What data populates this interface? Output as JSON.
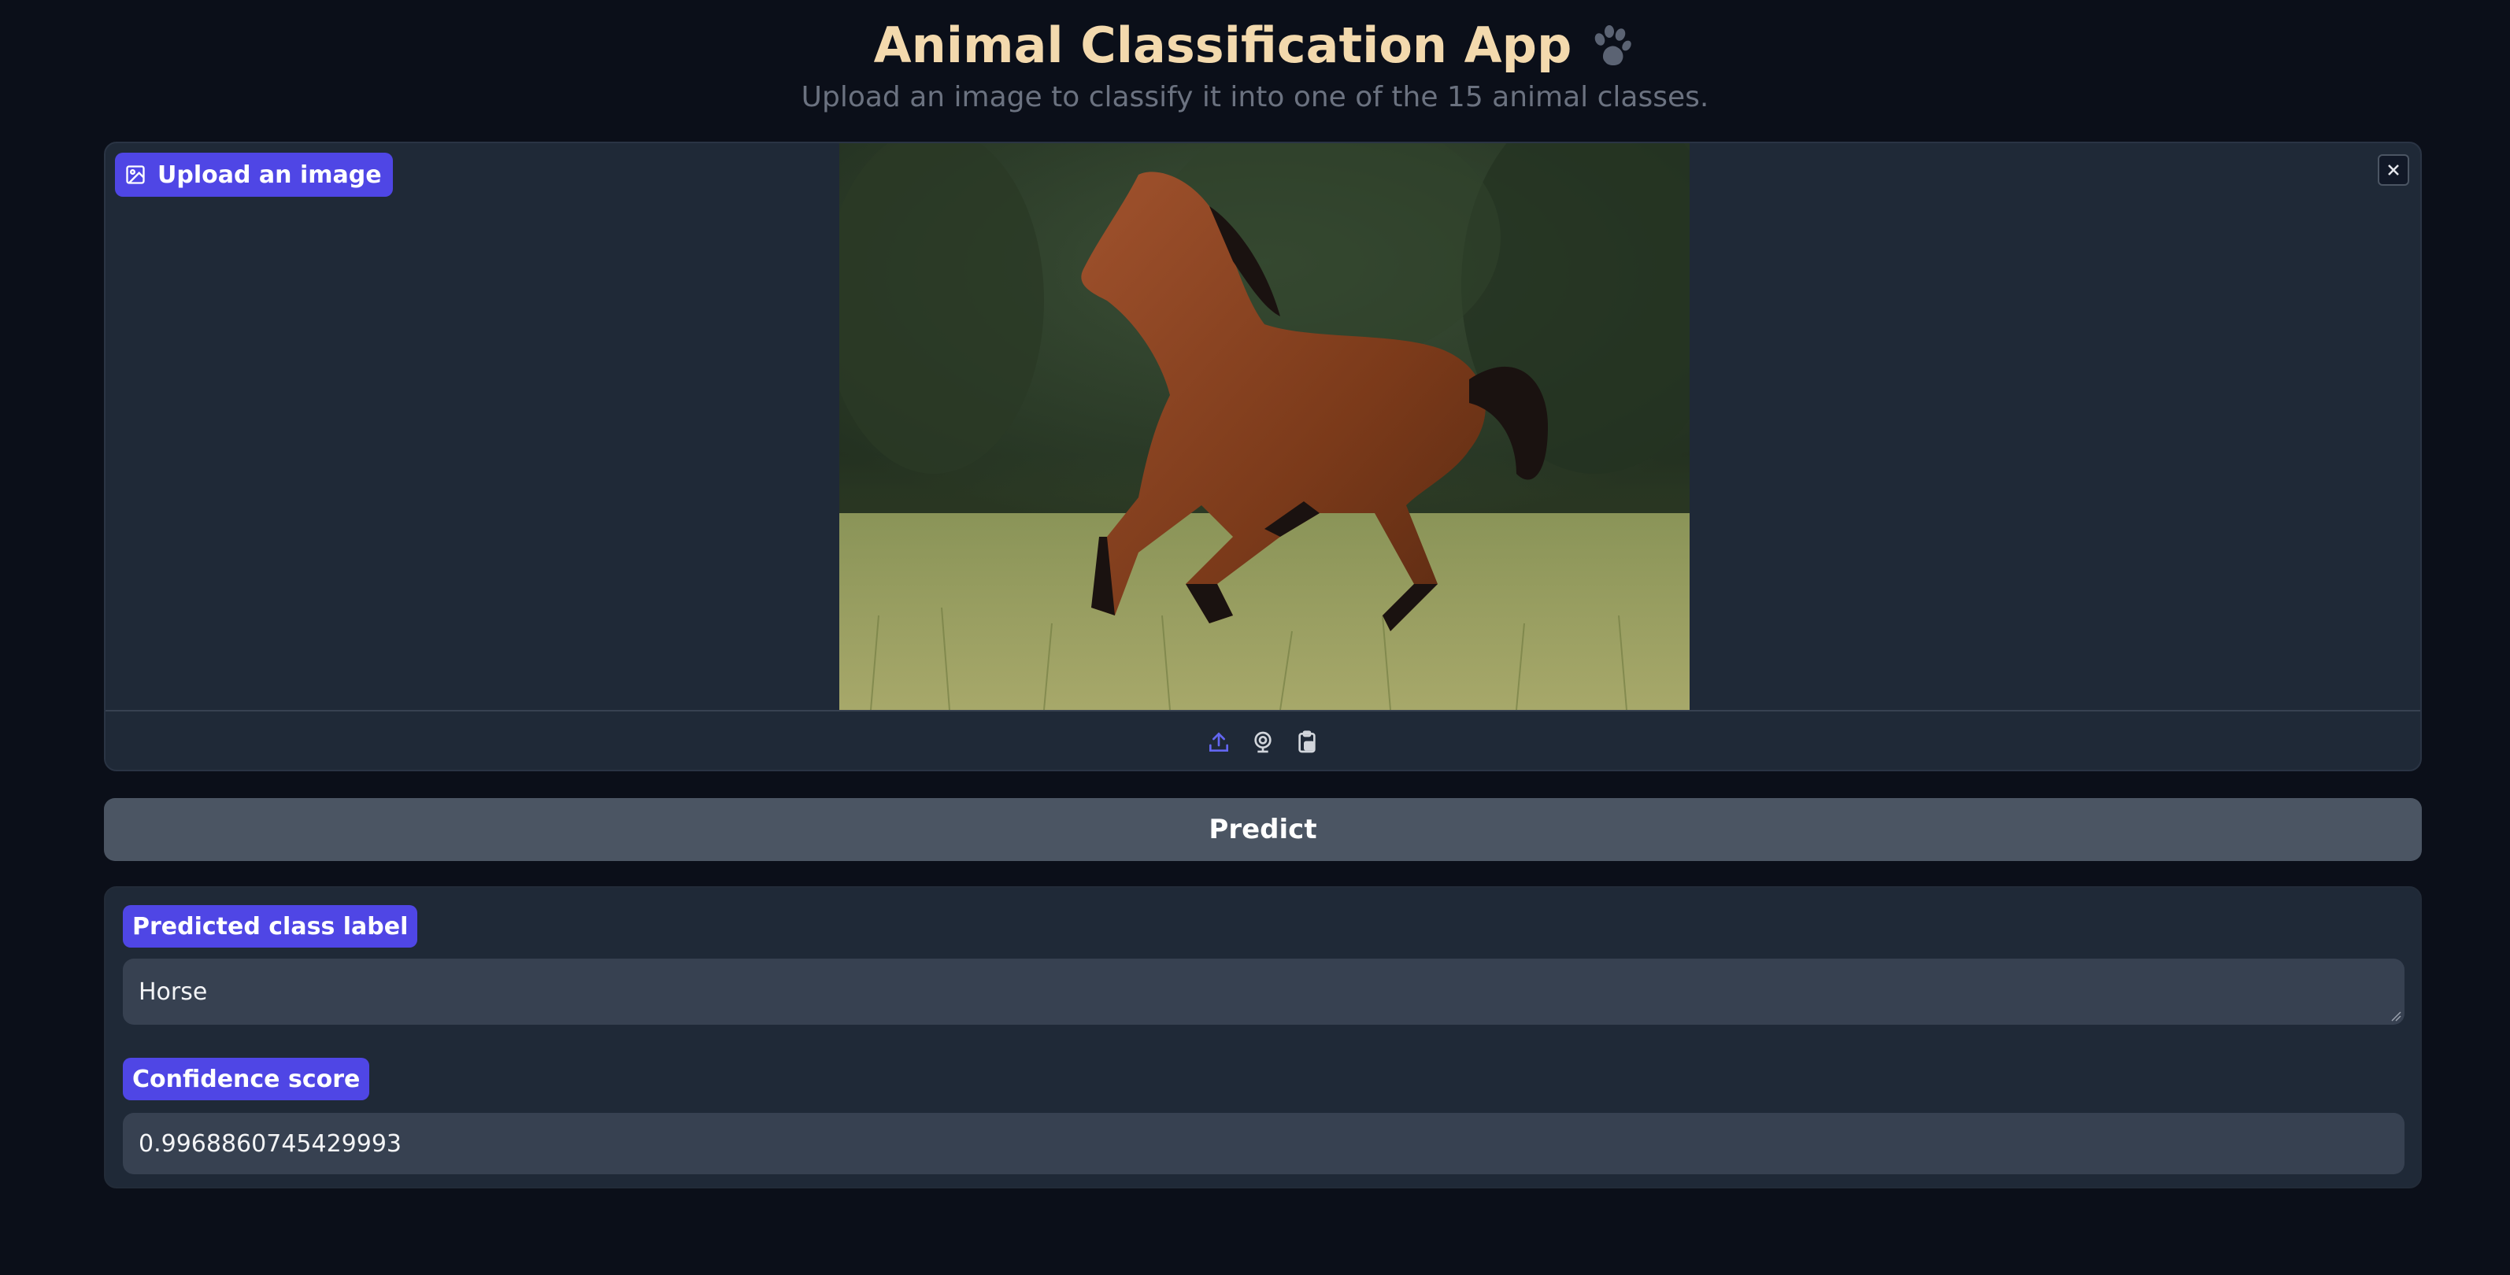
{
  "header": {
    "title": "Animal Classification App",
    "subtitle": "Upload an image to classify it into one of the 15 animal classes."
  },
  "image_input": {
    "label": "Upload an image",
    "image_subject": "brown horse galloping in a grassy field",
    "source_icons": [
      "upload-icon",
      "webcam-icon",
      "clipboard-icon"
    ],
    "close_icon": "close-icon"
  },
  "predict_button": {
    "label": "Predict"
  },
  "outputs": {
    "class_label_title": "Predicted class label",
    "class_label_value": "Horse",
    "confidence_title": "Confidence score",
    "confidence_value": "0.9968860745429993"
  },
  "colors": {
    "background": "#0b0f19",
    "panel": "#1f2937",
    "accent": "#4f46e5",
    "title": "#f3d9ad",
    "button": "#4b5563",
    "field": "#374151"
  }
}
